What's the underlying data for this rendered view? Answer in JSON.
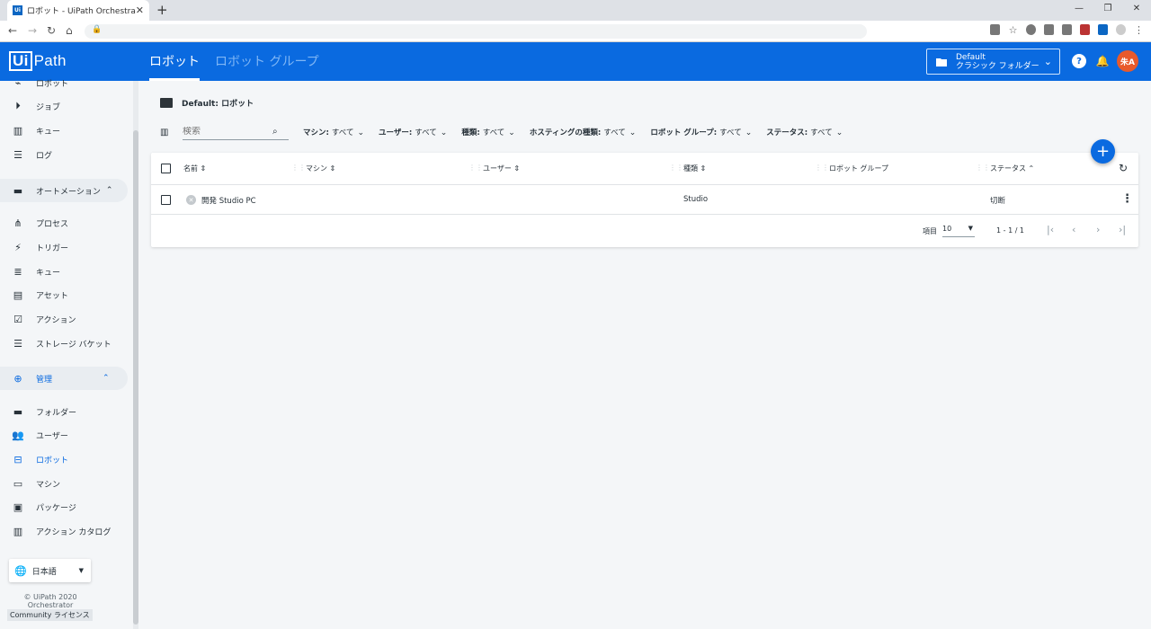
{
  "browser": {
    "tab_title": "ロボット - UiPath Orchestrator",
    "favicon_text": "Ui",
    "new_tab": "+",
    "window_controls": [
      "—",
      "❐",
      "✕"
    ]
  },
  "appbar": {
    "logo_box": "Ui",
    "logo_text": "Path",
    "tabs": [
      {
        "label": "ロボット",
        "active": true
      },
      {
        "label": "ロボット グループ",
        "active": false
      }
    ],
    "folder_line1": "Default",
    "folder_line2": "クラシック フォルダー",
    "avatar": "朱A",
    "accent": "#0a6ae0"
  },
  "sidebar": {
    "top_items": [
      {
        "label": "ロボット",
        "icon": "robot-icon"
      },
      {
        "label": "ジョブ",
        "icon": "play-icon"
      },
      {
        "label": "キュー",
        "icon": "chart-icon"
      },
      {
        "label": "ログ",
        "icon": "log-icon"
      }
    ],
    "automation_section": "オートメーション",
    "automation_items": [
      {
        "label": "プロセス",
        "icon": "process-icon"
      },
      {
        "label": "トリガー",
        "icon": "trigger-icon"
      },
      {
        "label": "キュー",
        "icon": "queue-icon"
      },
      {
        "label": "アセット",
        "icon": "asset-icon"
      },
      {
        "label": "アクション",
        "icon": "action-icon"
      },
      {
        "label": "ストレージ バケット",
        "icon": "storage-icon"
      }
    ],
    "admin_section": "管理",
    "admin_items": [
      {
        "label": "フォルダー",
        "icon": "folder-icon"
      },
      {
        "label": "ユーザー",
        "icon": "users-icon"
      },
      {
        "label": "ロボット",
        "icon": "robot-icon",
        "active": true
      },
      {
        "label": "マシン",
        "icon": "machine-icon"
      },
      {
        "label": "パッケージ",
        "icon": "package-icon"
      },
      {
        "label": "アクション カタログ",
        "icon": "catalog-icon"
      }
    ],
    "language": "日本語",
    "copyright1": "© UiPath 2020",
    "copyright2": "Orchestrator",
    "license": "Community ライセンス"
  },
  "main": {
    "breadcrumb": "Default: ロボット",
    "search_placeholder": "検索",
    "filters": [
      {
        "key": "マシン",
        "value": "すべて"
      },
      {
        "key": "ユーザー",
        "value": "すべて"
      },
      {
        "key": "種類",
        "value": "すべて"
      },
      {
        "key": "ホスティングの種類",
        "value": "すべて"
      },
      {
        "key": "ロボット グループ",
        "value": "すべて"
      },
      {
        "key": "ステータス",
        "value": "すべて"
      }
    ],
    "columns": [
      "名前",
      "マシン",
      "ユーザー",
      "種類",
      "ロボット グループ",
      "ステータス"
    ],
    "rows": [
      {
        "name": "開発 Studio PC",
        "machine": "",
        "user": "",
        "type": "Studio",
        "group": "",
        "status": "切断"
      }
    ],
    "pager_label": "項目",
    "page_size": "10",
    "page_range": "1 - 1 / 1"
  }
}
